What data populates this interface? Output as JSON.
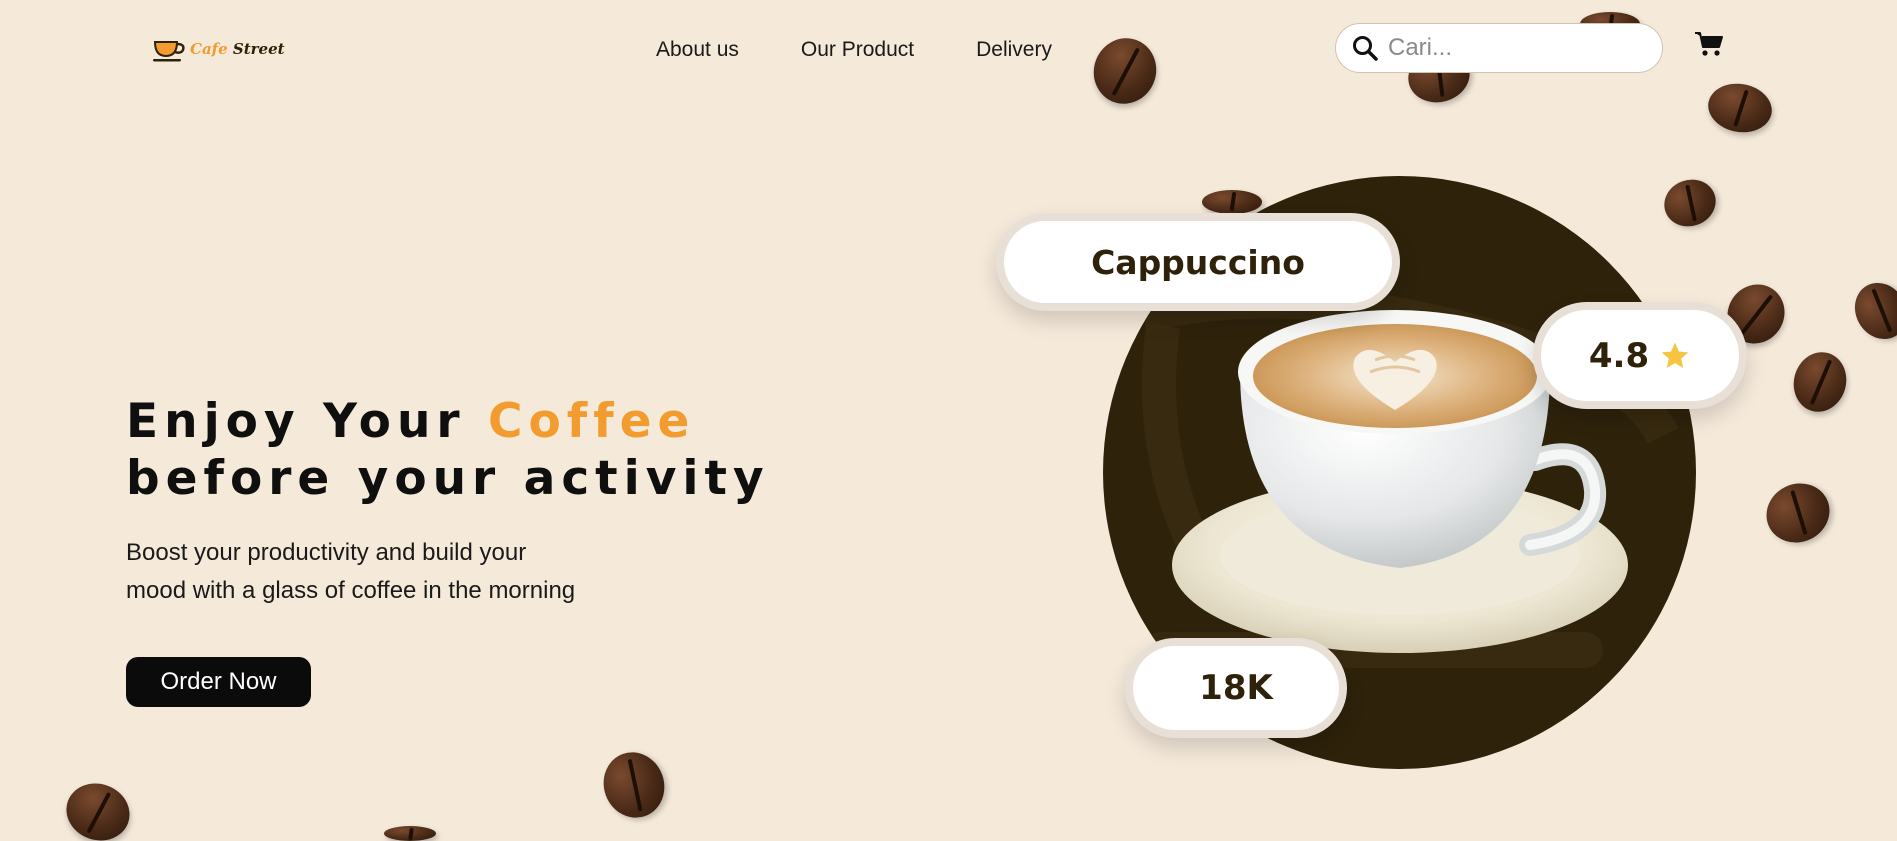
{
  "brand": {
    "name_part1": "Cafe",
    "name_part2": "Street",
    "accent_color": "#f29b2e",
    "dark_color": "#2e220b"
  },
  "nav": {
    "items": [
      {
        "label": "About us"
      },
      {
        "label": "Our Product"
      },
      {
        "label": "Delivery"
      }
    ]
  },
  "search": {
    "placeholder": "Cari..."
  },
  "hero": {
    "title_line1_prefix": "Enjoy Your ",
    "title_line1_accent": "Coffee",
    "title_line2": "before your activity",
    "subtitle_line1": "Boost your productivity and build your",
    "subtitle_line2": "mood with a glass of coffee in the morning",
    "cta_label": "Order Now"
  },
  "product": {
    "name": "Cappuccino",
    "rating": "4.8",
    "count": "18K"
  },
  "icons": {
    "search": "search-icon",
    "cart": "cart-icon",
    "star": "star-icon",
    "logo": "coffee-cup-logo-icon"
  }
}
